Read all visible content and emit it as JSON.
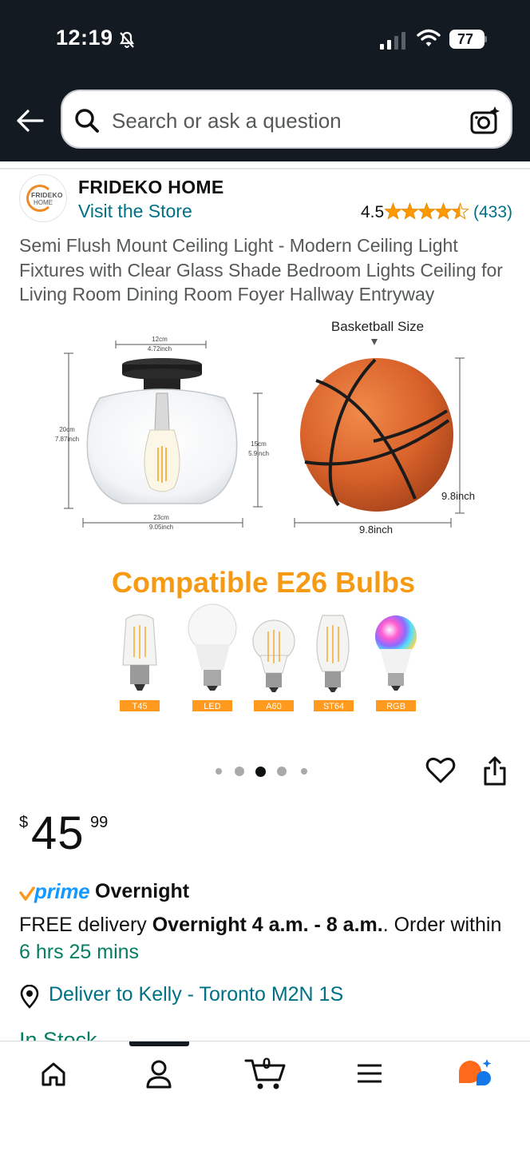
{
  "status_bar": {
    "time": "12:19",
    "battery": "77"
  },
  "search": {
    "placeholder": "Search or ask a question"
  },
  "store": {
    "logo_line1": "FRIDEKO",
    "logo_line2": "HOME",
    "name": "FRIDEKO HOME",
    "visit_label": "Visit the Store",
    "rating": "4.5",
    "rating_value": 4.5,
    "review_count": "(433)"
  },
  "product": {
    "title": "Semi Flush Mount Ceiling Light - Modern Ceiling Light Fixtures with Clear Glass Shade Bedroom Lights Ceiling for Living Room Dining Room Foyer Hallway Entryway"
  },
  "image": {
    "width_top_cm": "12cm",
    "width_top_in": "4.72inch",
    "height_cm": "20cm",
    "height_in": "7.87inch",
    "shade_cm": "15cm",
    "shade_in": "5.9inch",
    "width_bottom_cm": "23cm",
    "width_bottom_in": "9.05inch",
    "basketball_label": "Basketball Size",
    "ball_height": "9.8inch",
    "ball_width": "9.8inch",
    "bulbs_heading": "Compatible E26 Bulbs",
    "bulbs": [
      "T45",
      "LED",
      "A60",
      "ST64",
      "RGB"
    ]
  },
  "carousel": {
    "count": 5,
    "active_index": 2
  },
  "price": {
    "symbol": "$",
    "whole": "45",
    "fraction": "99"
  },
  "delivery": {
    "prime_label": "prime",
    "prime_speed": "Overnight",
    "free_prefix": "FREE delivery ",
    "window": "Overnight 4 a.m. - 8 a.m.",
    "order_within": ". Order within ",
    "countdown": "6 hrs 25 mins",
    "deliver_to": "Deliver to Kelly - Toronto M2N 1S",
    "stock": "In Stock"
  },
  "nav": {
    "cart_count": "0"
  },
  "colors": {
    "header_bg": "#131a22",
    "link": "#007185",
    "star": "#ff9900",
    "prime_blue": "#1399ff",
    "success_green": "#067d62",
    "bulb_label_bg": "#ff9a1f"
  },
  "icons": [
    "bell-off-icon",
    "signal-icon",
    "wifi-icon",
    "back-arrow-icon",
    "search-icon",
    "camera-icon",
    "heart-icon",
    "share-icon",
    "location-pin-icon",
    "home-icon",
    "profile-icon",
    "cart-icon",
    "menu-icon",
    "rufus-icon"
  ]
}
